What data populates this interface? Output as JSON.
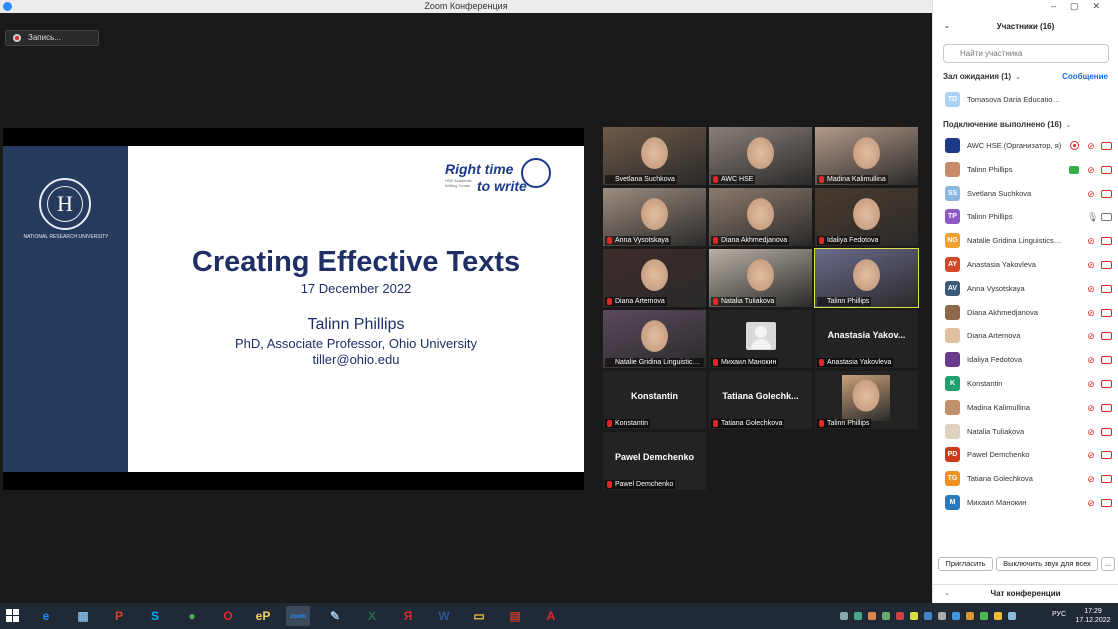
{
  "window": {
    "title": "Zoom Конференция"
  },
  "recording": {
    "label": "Запись..."
  },
  "slide": {
    "logo_text": "Right time\nto write",
    "logo_line1": "Right time",
    "logo_line2": "to write",
    "logo_sub": "HSE Academic Writing Center",
    "university": "NATIONAL RESEARCH UNIVERSITY",
    "title": "Creating Effective Texts",
    "date": "17 December 2022",
    "speaker": "Talinn Phillips",
    "role": "PhD, Associate Professor, Ohio University",
    "email": "tiller@ohio.edu"
  },
  "tiles": [
    {
      "name": "Svetlana Suchkova",
      "muted": false,
      "kind": "video",
      "color": "#6e5a48"
    },
    {
      "name": "AWC HSE",
      "muted": true,
      "kind": "video",
      "color": "#8a7f78"
    },
    {
      "name": "Madina Kalimullina",
      "muted": true,
      "kind": "video",
      "color": "#b39a88"
    },
    {
      "name": "Anna Vysotskaya",
      "muted": true,
      "kind": "video",
      "color": "#9d8c7e"
    },
    {
      "name": "Diana Akhmedjanova",
      "muted": true,
      "kind": "video",
      "color": "#8d7a6c"
    },
    {
      "name": "Idaliya Fedotova",
      "muted": true,
      "kind": "video",
      "color": "#4a3a2c"
    },
    {
      "name": "Diana Artemova",
      "muted": true,
      "kind": "video",
      "color": "#3d2c2a"
    },
    {
      "name": "Natalia Tuliakova",
      "muted": true,
      "kind": "video",
      "color": "#b8b0a4"
    },
    {
      "name": "Talinn Phillips",
      "muted": false,
      "kind": "video",
      "color": "#6a6a8c",
      "active": true
    },
    {
      "name": "Natalie Gridina Linguistics, ...",
      "muted": false,
      "kind": "video",
      "color": "#5a4a5c"
    },
    {
      "name": "Михаил Манокин",
      "muted": true,
      "kind": "avatar"
    },
    {
      "name": "Anastasia Yakovleva",
      "muted": true,
      "kind": "name",
      "big": "Anastasia Yakov..."
    },
    {
      "name": "Konstantin",
      "muted": true,
      "kind": "name",
      "big": "Konstantin"
    },
    {
      "name": "Tatiana Golechkova",
      "muted": true,
      "kind": "name",
      "big": "Tatiana Golechk..."
    },
    {
      "name": "Talinn Phillips",
      "muted": true,
      "kind": "photo",
      "color": "#c9a27a"
    },
    {
      "name": "Pawel Demchenko",
      "muted": true,
      "kind": "name",
      "big": "Pawel Demchenko"
    }
  ],
  "panel": {
    "title": "Участники (16)",
    "search_placeholder": "Найти участника",
    "waiting_label": "Зал ожидания (1)",
    "admit_label": "Сообщение",
    "waiting": [
      {
        "initials": "TD",
        "name": "Tomasova Daria Educational sciences",
        "color": "#a9d2f3"
      }
    ],
    "connected_label": "Подключение выполнено (16)",
    "participants": [
      {
        "initials": "",
        "name": "AWC HSE (Организатор, я)",
        "color": "#1b3b8a",
        "mic": "muted",
        "cam": "off",
        "extra": "rec"
      },
      {
        "initials": "",
        "name": "Talinn Phillips",
        "color": "#c98a6a",
        "mic": "muted",
        "cam": "off",
        "extra": "share"
      },
      {
        "initials": "SS",
        "name": "Svetlana Suchkova",
        "color": "#8ab6e0",
        "mic": "muted",
        "cam": "off"
      },
      {
        "initials": "TP",
        "name": "Talinn Phillips",
        "color": "#8c5ac8",
        "mic": "on",
        "cam": "on"
      },
      {
        "initials": "NG",
        "name": "Natalie Gridina Linguistics, Meth...",
        "color": "#f0a030",
        "mic": "muted",
        "cam": "off"
      },
      {
        "initials": "AY",
        "name": "Anastasia Yakovleva",
        "color": "#d04a2a",
        "mic": "muted",
        "cam": "off"
      },
      {
        "initials": "AV",
        "name": "Anna Vysotskaya",
        "color": "#3a5a78",
        "mic": "muted",
        "cam": "off"
      },
      {
        "initials": "",
        "name": "Diana Akhmedjanova",
        "color": "#8d6a4a",
        "mic": "muted",
        "cam": "off"
      },
      {
        "initials": "",
        "name": "Diana Artemova",
        "color": "#e0c0a0",
        "mic": "muted",
        "cam": "off"
      },
      {
        "initials": "",
        "name": "Idaliya Fedotova",
        "color": "#6a3a8c",
        "mic": "muted",
        "cam": "off"
      },
      {
        "initials": "K",
        "name": "Konstantin",
        "color": "#20a070",
        "mic": "muted",
        "cam": "off"
      },
      {
        "initials": "",
        "name": "Madina Kalimullina",
        "color": "#c0906a",
        "mic": "muted",
        "cam": "off"
      },
      {
        "initials": "",
        "name": "Natalia Tuliakova",
        "color": "#e0d0c0",
        "mic": "muted",
        "cam": "off"
      },
      {
        "initials": "PD",
        "name": "Pawel Demchenko",
        "color": "#d03a1a",
        "mic": "muted",
        "cam": "off"
      },
      {
        "initials": "TG",
        "name": "Tatiana Golechkova",
        "color": "#f09020",
        "mic": "muted",
        "cam": "off"
      },
      {
        "initials": "M",
        "name": "Михаил Манокин",
        "color": "#2a7ac0",
        "mic": "muted",
        "cam": "off"
      }
    ],
    "invite_label": "Пригласить",
    "mute_all_label": "Выключить звук для всех",
    "more_label": "...",
    "chat_label": "Чат конференции"
  },
  "taskbar": {
    "apps": [
      {
        "icon": "internet-explorer-icon",
        "glyph": "e",
        "color": "#1e90ff"
      },
      {
        "icon": "calculator-icon",
        "glyph": "▦",
        "color": "#7fb5e0"
      },
      {
        "icon": "powerpoint-icon",
        "glyph": "P",
        "color": "#d24726"
      },
      {
        "icon": "skype-icon",
        "glyph": "S",
        "color": "#00aff0"
      },
      {
        "icon": "chrome-icon",
        "glyph": "●",
        "color": "#4caf50"
      },
      {
        "icon": "opera-icon",
        "glyph": "O",
        "color": "#e0282e"
      },
      {
        "icon": "epanel-icon",
        "glyph": "eP",
        "color": "#f0d060"
      },
      {
        "icon": "zoom-icon",
        "glyph": "zoom",
        "color": "#2d8cff"
      },
      {
        "icon": "paint-icon",
        "glyph": "✎",
        "color": "#9fc5e8"
      },
      {
        "icon": "excel-icon",
        "glyph": "X",
        "color": "#217346"
      },
      {
        "icon": "yandex-icon",
        "glyph": "Я",
        "color": "#e0282e"
      },
      {
        "icon": "word-icon",
        "glyph": "W",
        "color": "#2b5797"
      },
      {
        "icon": "explorer-icon",
        "glyph": "▭",
        "color": "#f0c040"
      },
      {
        "icon": "reader-icon",
        "glyph": "▤",
        "color": "#c0392b"
      },
      {
        "icon": "acrobat-icon",
        "glyph": "A",
        "color": "#e0282e"
      }
    ],
    "lang": "РУС",
    "time": "17:29",
    "date": "17.12.2022",
    "tray_badges": [
      "28",
      "37"
    ]
  }
}
